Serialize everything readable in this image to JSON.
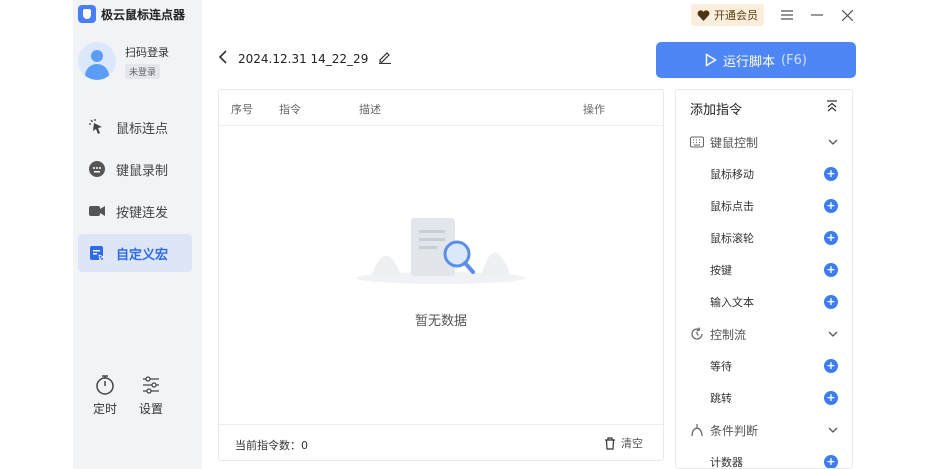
{
  "app": {
    "title": "极云鼠标连点器"
  },
  "user": {
    "name": "扫码登录",
    "status": "未登录"
  },
  "nav": {
    "items": [
      {
        "label": "鼠标连点",
        "icon": "cursor-click-icon"
      },
      {
        "label": "键鼠录制",
        "icon": "record-icon"
      },
      {
        "label": "按键连发",
        "icon": "video-icon"
      },
      {
        "label": "自定义宏",
        "icon": "macro-icon"
      }
    ],
    "active_index": 3
  },
  "tools": {
    "timer": "定时",
    "settings": "设置"
  },
  "topbar": {
    "vip": "开通会员"
  },
  "file": {
    "name": "2024.12.31 14_22_29"
  },
  "run": {
    "label": "运行脚本",
    "hotkey": "(F6)"
  },
  "table": {
    "columns": [
      "序号",
      "指令",
      "描述",
      "操作"
    ],
    "empty_text": "暂无数据",
    "count_label": "当前指令数：0",
    "clear": "清空"
  },
  "panel": {
    "title": "添加指令",
    "groups": [
      {
        "label": "键鼠控制",
        "items": [
          "鼠标移动",
          "鼠标点击",
          "鼠标滚轮",
          "按键",
          "输入文本"
        ]
      },
      {
        "label": "控制流",
        "items": [
          "等待",
          "跳转"
        ]
      },
      {
        "label": "条件判断",
        "items": [
          "计数器"
        ]
      }
    ]
  },
  "colors": {
    "accent": "#4f86f6",
    "sidebar": "#f1f3f7",
    "active": "#dde6f7"
  }
}
